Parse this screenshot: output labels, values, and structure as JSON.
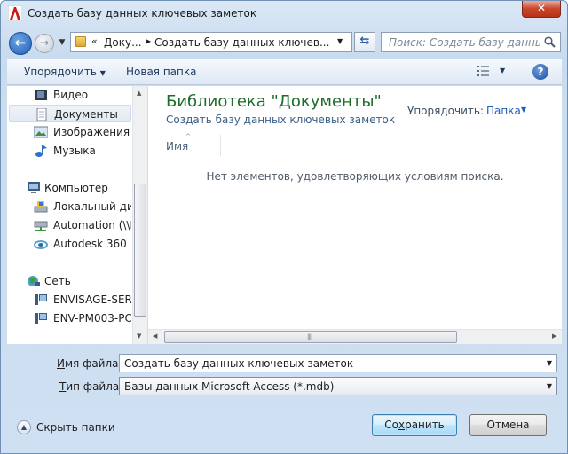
{
  "window": {
    "title": "Создать базу данных ключевых заметок",
    "close_label": "✕"
  },
  "address": {
    "overflow": "«",
    "crumb1": "Доку...",
    "crumb2": "Создать базу данных ключев..."
  },
  "search": {
    "placeholder": "Поиск: Создать базу данных..."
  },
  "toolbar": {
    "organize_label": "Упорядочить",
    "new_folder_label": "Новая папка",
    "help_label": "?"
  },
  "nav": {
    "items": [
      {
        "label": "Видео",
        "icon": "video-icon"
      },
      {
        "label": "Документы",
        "icon": "documents-icon",
        "selected": true
      },
      {
        "label": "Изображения",
        "icon": "images-icon"
      },
      {
        "label": "Музыка",
        "icon": "music-icon"
      },
      {
        "label": "Компьютер",
        "icon": "computer-icon"
      },
      {
        "label": "Локальный диск",
        "icon": "local-disk-icon"
      },
      {
        "label": "Automation (\\\\El",
        "icon": "network-drive-icon"
      },
      {
        "label": "Autodesk 360",
        "icon": "autodesk-360-icon"
      },
      {
        "label": "Сеть",
        "icon": "network-icon"
      },
      {
        "label": "ENVISAGE-SERVE",
        "icon": "pc-icon"
      },
      {
        "label": "ENV-PM003-PC",
        "icon": "pc-icon"
      }
    ]
  },
  "content": {
    "library_title": "Библиотека \"Документы\"",
    "library_subtitle": "Создать базу данных ключевых заметок",
    "arrange_label": "Упорядочить:",
    "arrange_value": "Папка",
    "column_name": "Имя",
    "empty_message": "Нет элементов, удовлетворяющих условиям поиска."
  },
  "form": {
    "filename_label_prefix": "",
    "filename_label_key": "И",
    "filename_label_rest": "мя файла:",
    "filename_value": "Создать базу данных ключевых заметок",
    "filetype_label_key": "Т",
    "filetype_label_rest": "ип файла:",
    "filetype_value": "Базы данных Microsoft Access  (*.mdb)"
  },
  "footer": {
    "hide_folders_label": "Скрыть папки",
    "save_label_pre": "Со",
    "save_label_key": "х",
    "save_label_post": "ранить",
    "cancel_label": "Отмена"
  }
}
